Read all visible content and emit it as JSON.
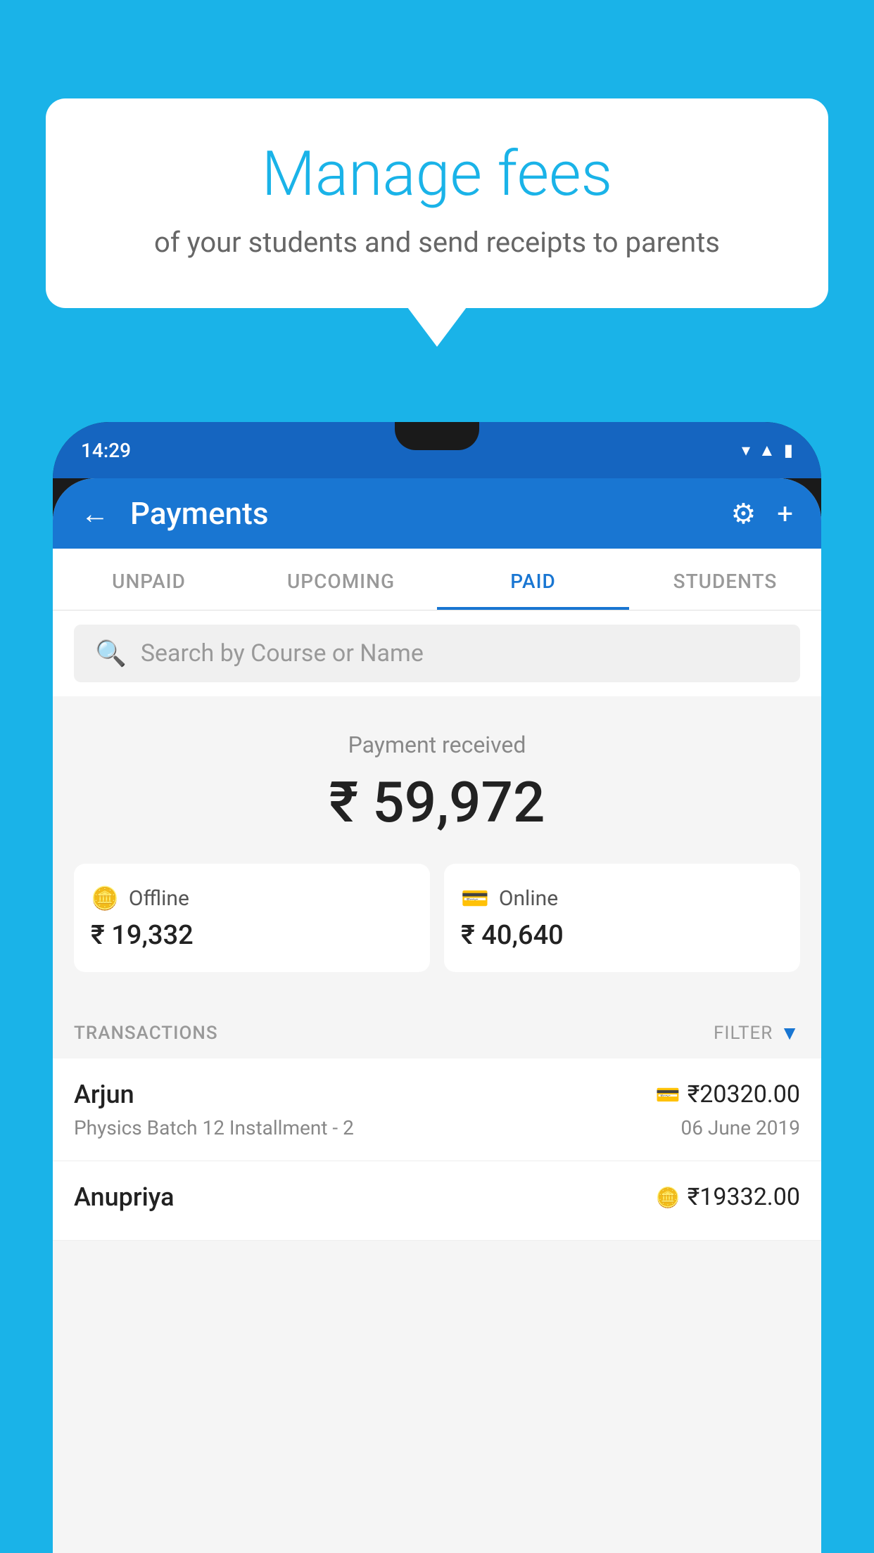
{
  "background_color": "#1ab3e8",
  "bubble": {
    "title": "Manage fees",
    "subtitle": "of your students and send receipts to parents"
  },
  "phone": {
    "status_bar": {
      "time": "14:29"
    },
    "header": {
      "title": "Payments",
      "back_label": "←",
      "settings_label": "⚙",
      "add_label": "+"
    },
    "tabs": [
      {
        "label": "UNPAID",
        "active": false
      },
      {
        "label": "UPCOMING",
        "active": false
      },
      {
        "label": "PAID",
        "active": true
      },
      {
        "label": "STUDENTS",
        "active": false
      }
    ],
    "search": {
      "placeholder": "Search by Course or Name"
    },
    "payment_summary": {
      "label": "Payment received",
      "total": "₹ 59,972",
      "offline": {
        "type": "Offline",
        "amount": "₹ 19,332"
      },
      "online": {
        "type": "Online",
        "amount": "₹ 40,640"
      }
    },
    "transactions": {
      "header_label": "TRANSACTIONS",
      "filter_label": "FILTER",
      "rows": [
        {
          "name": "Arjun",
          "amount": "₹20320.00",
          "description": "Physics Batch 12 Installment - 2",
          "date": "06 June 2019",
          "payment_icon": "card"
        },
        {
          "name": "Anupriya",
          "amount": "₹19332.00",
          "description": "",
          "date": "",
          "payment_icon": "cash"
        }
      ]
    }
  }
}
